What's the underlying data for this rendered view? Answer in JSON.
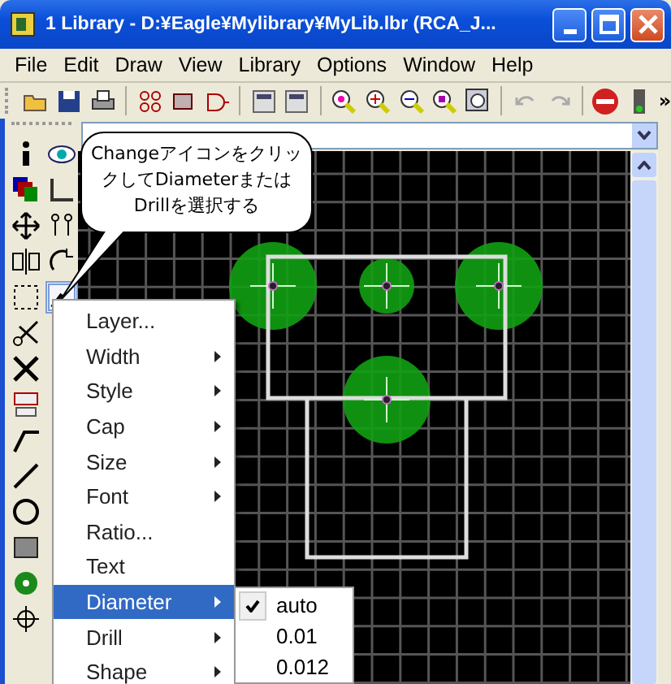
{
  "window": {
    "title": "1 Library - D:¥Eagle¥Mylibrary¥MyLib.lbr (RCA_J..."
  },
  "menu": [
    {
      "label": "File"
    },
    {
      "label": "Edit"
    },
    {
      "label": "Draw"
    },
    {
      "label": "View"
    },
    {
      "label": "Library"
    },
    {
      "label": "Options"
    },
    {
      "label": "Window"
    },
    {
      "label": "Help"
    }
  ],
  "toolbar_overflow": "»",
  "callout": {
    "text": "ChangeアイコンをクリックしてDiameterまたはDrillを選択する"
  },
  "context_menu": [
    {
      "label": "Layer...",
      "submenu": false,
      "selected": false
    },
    {
      "label": "Width",
      "submenu": true,
      "selected": false
    },
    {
      "label": "Style",
      "submenu": true,
      "selected": false
    },
    {
      "label": "Cap",
      "submenu": true,
      "selected": false
    },
    {
      "label": "Size",
      "submenu": true,
      "selected": false
    },
    {
      "label": "Font",
      "submenu": true,
      "selected": false
    },
    {
      "label": "Ratio...",
      "submenu": false,
      "selected": false
    },
    {
      "label": "Text",
      "submenu": false,
      "selected": false
    },
    {
      "label": "Diameter",
      "submenu": true,
      "selected": true
    },
    {
      "label": "Drill",
      "submenu": true,
      "selected": false
    },
    {
      "label": "Shape",
      "submenu": true,
      "selected": false
    }
  ],
  "submenu": [
    {
      "label": "auto",
      "checked": true
    },
    {
      "label": "0.01",
      "checked": false
    },
    {
      "label": "0.012",
      "checked": false
    }
  ]
}
